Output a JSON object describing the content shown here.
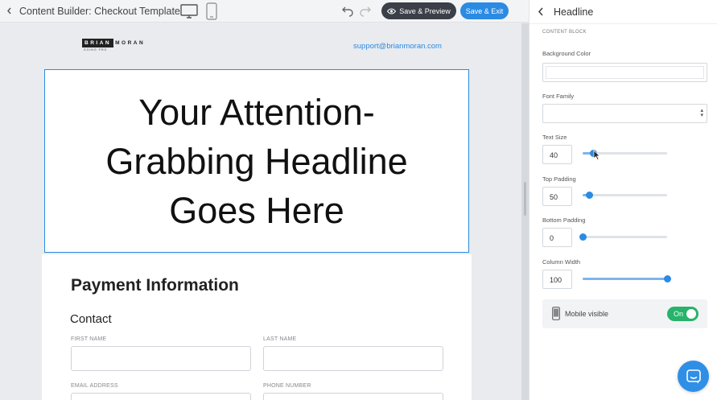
{
  "topbar": {
    "back_icon": "chevron-left-icon",
    "title": "Content Builder: Checkout Template",
    "preview_label": "Save & Preview",
    "exit_label": "Save & Exit"
  },
  "canvas": {
    "logo": {
      "brand_box": "BRIAN",
      "brand_rest": "MORAN",
      "sub": "GOING PRO"
    },
    "support_email": "support@brianmoran.com",
    "headline": "Your Attention-Grabbing Headline Goes Here",
    "form": {
      "title": "Payment Information",
      "contact_heading": "Contact",
      "labels": {
        "first_name": "FIRST NAME",
        "last_name": "LAST NAME",
        "email": "EMAIL ADDRESS",
        "phone": "PHONE NUMBER"
      }
    }
  },
  "panel": {
    "title": "Headline",
    "section": "CONTENT BLOCK",
    "background_color_label": "Background Color",
    "font_family_label": "Font Family",
    "text_size": {
      "label": "Text Size",
      "value": "40",
      "level": 0.12
    },
    "top_padding": {
      "label": "Top Padding",
      "value": "50",
      "level": 0.08
    },
    "bottom_padding": {
      "label": "Bottom Padding",
      "value": "0",
      "level": 0.0
    },
    "column_width": {
      "label": "Column Width",
      "value": "100",
      "level": 1.0
    },
    "mobile": {
      "label": "Mobile visible",
      "toggle_label": "On",
      "enabled": true
    }
  },
  "colors": {
    "accent": "#2b8be3",
    "toggle_on": "#27b36b",
    "preview_button": "#3b3f47"
  }
}
